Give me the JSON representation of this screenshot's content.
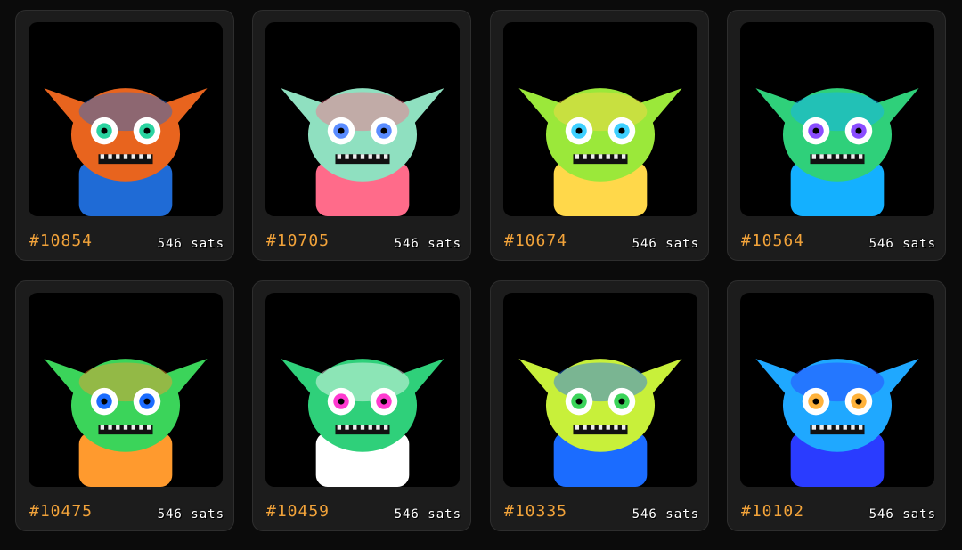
{
  "colors": {
    "accent": "#f2a33a",
    "card_bg": "#1c1c1c",
    "page_bg": "#0b0b0b"
  },
  "items": [
    {
      "number": "#10854",
      "price": "546 sats",
      "palette": [
        "#e8641e",
        "#2ad3a0",
        "#1f6bd6"
      ]
    },
    {
      "number": "#10705",
      "price": "546 sats",
      "palette": [
        "#8fe0c0",
        "#5a8cff",
        "#ff6b8a"
      ]
    },
    {
      "number": "#10674",
      "price": "546 sats",
      "palette": [
        "#9be83a",
        "#3fd0ff",
        "#ffd84a"
      ]
    },
    {
      "number": "#10564",
      "price": "546 sats",
      "palette": [
        "#2fd07a",
        "#8a4dff",
        "#14b0ff"
      ]
    },
    {
      "number": "#10475",
      "price": "546 sats",
      "palette": [
        "#3bd45a",
        "#1b6cff",
        "#ff9a2e"
      ]
    },
    {
      "number": "#10459",
      "price": "546 sats",
      "palette": [
        "#2fd07a",
        "#ff3ad0",
        "#ffffff"
      ]
    },
    {
      "number": "#10335",
      "price": "546 sats",
      "palette": [
        "#c8f03a",
        "#3bd45a",
        "#1b6cff"
      ]
    },
    {
      "number": "#10102",
      "price": "546 sats",
      "palette": [
        "#1fa8ff",
        "#ffb23a",
        "#2a3cff"
      ]
    }
  ]
}
